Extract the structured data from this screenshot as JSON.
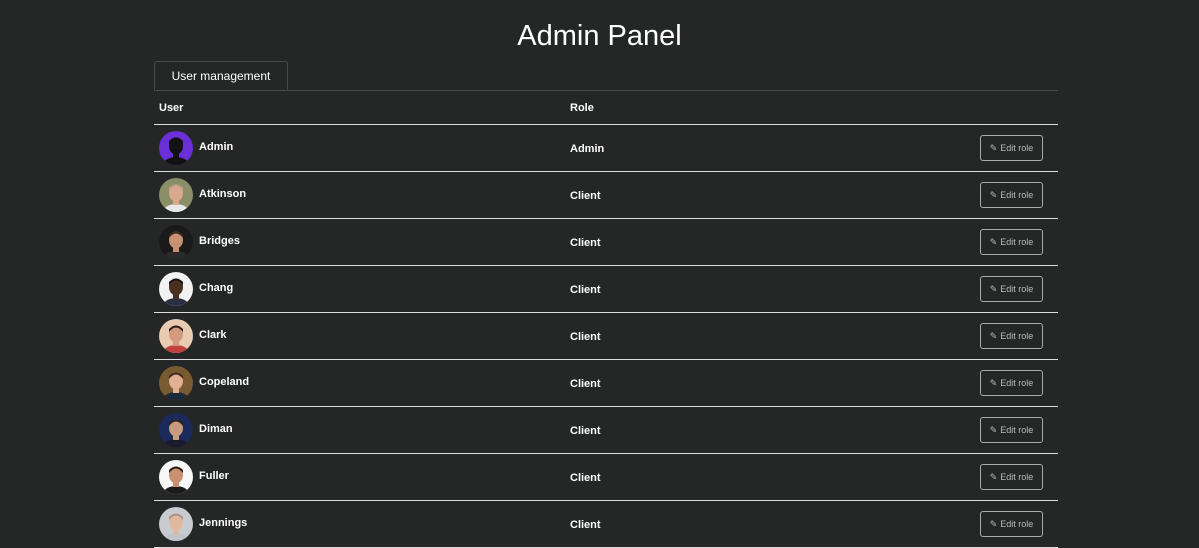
{
  "header": {
    "title": "Admin Panel"
  },
  "tabs": [
    {
      "label": "User management",
      "active": true
    }
  ],
  "table": {
    "columns": {
      "user": "User",
      "role": "Role"
    },
    "edit_label": "Edit role",
    "rows": [
      {
        "name": "Admin",
        "role": "Admin",
        "avatar": {
          "bg": "#6a2fd6",
          "skin": "#111111",
          "shirt": "#111111",
          "hair": "#111111"
        }
      },
      {
        "name": "Atkinson",
        "role": "Client",
        "avatar": {
          "bg": "#8a8f6a",
          "skin": "#d8a890",
          "shirt": "#e8e8e8",
          "hair": "#c8a080"
        }
      },
      {
        "name": "Bridges",
        "role": "Client",
        "avatar": {
          "bg": "#1a1a1a",
          "skin": "#c89070",
          "shirt": "#2a2a2a",
          "hair": "#3a2a20"
        }
      },
      {
        "name": "Chang",
        "role": "Client",
        "avatar": {
          "bg": "#f2f2f2",
          "skin": "#4a3020",
          "shirt": "#2a2f40",
          "hair": "#1a1410"
        }
      },
      {
        "name": "Clark",
        "role": "Client",
        "avatar": {
          "bg": "#e8cbb0",
          "skin": "#d49a80",
          "shirt": "#c04040",
          "hair": "#2a1a12"
        }
      },
      {
        "name": "Copeland",
        "role": "Client",
        "avatar": {
          "bg": "#7a5a30",
          "skin": "#e0b090",
          "shirt": "#1a2a3a",
          "hair": "#3a2a1a"
        }
      },
      {
        "name": "Diman",
        "role": "Client",
        "avatar": {
          "bg": "#1a2a5a",
          "skin": "#c89a80",
          "shirt": "#1a1a2a",
          "hair": "#2a2018"
        }
      },
      {
        "name": "Fuller",
        "role": "Client",
        "avatar": {
          "bg": "#f8f8f8",
          "skin": "#c89070",
          "shirt": "#1a1a1a",
          "hair": "#2a1a10"
        }
      },
      {
        "name": "Jennings",
        "role": "Client",
        "avatar": {
          "bg": "#c8ccd0",
          "skin": "#e0b8a0",
          "shirt": "#c0c4c8",
          "hair": "#a89080"
        }
      }
    ]
  }
}
